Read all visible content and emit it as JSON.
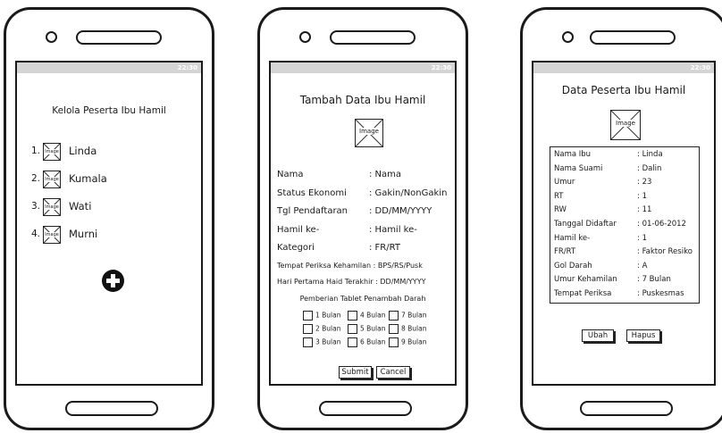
{
  "status_bar": {
    "time": "22:30"
  },
  "placeholder_image_label": "Image",
  "screen1": {
    "title": "Kelola Peserta Ibu Hamil",
    "items": [
      {
        "num": "1.",
        "name": "Linda"
      },
      {
        "num": "2.",
        "name": "Kumala"
      },
      {
        "num": "3.",
        "name": "Wati"
      },
      {
        "num": "4.",
        "name": "Murni"
      }
    ],
    "add_icon": "plus-circle-icon"
  },
  "screen2": {
    "title": "Tambah Data Ibu Hamil",
    "fields": [
      {
        "label": "Nama",
        "value": ": Nama"
      },
      {
        "label": "Status Ekonomi",
        "value": ": Gakin/NonGakin"
      },
      {
        "label": "Tgl Pendaftaran",
        "value": ": DD/MM/YYYY"
      },
      {
        "label": "Hamil ke-",
        "value": ": Hamil ke-"
      },
      {
        "label": "Kategori",
        "value": ": FR/RT"
      }
    ],
    "tempat_periksa": "Tempat Periksa Kehamilan : BPS/RS/Pusk",
    "hari_pertama_haid": "Hari Pertama Haid Terakhir : DD/MM/YYYY",
    "tablet_title": "Pemberian Tablet Penambah Darah",
    "checkbox_rows": [
      [
        "1 Bulan",
        "4 Bulan",
        "7 Bulan"
      ],
      [
        "2 Bulan",
        "5 Bulan",
        "8 Bulan"
      ],
      [
        "3 Bulan",
        "6 Bulan",
        "9 Bulan"
      ]
    ],
    "submit_label": "Submit",
    "cancel_label": "Cancel"
  },
  "screen3": {
    "title": "Data Peserta Ibu Hamil",
    "rows": [
      {
        "label": "Nama Ibu",
        "value": ": Linda"
      },
      {
        "label": "Nama Suami",
        "value": ": Dalin"
      },
      {
        "label": "Umur",
        "value": ": 23"
      },
      {
        "label": "RT",
        "value": ": 1"
      },
      {
        "label": "RW",
        "value": ": 11"
      },
      {
        "label": "Tanggal Didaftar",
        "value": ": 01-06-2012"
      },
      {
        "label": "Hamil ke-",
        "value": ": 1"
      },
      {
        "label": "FR/RT",
        "value": ": Faktor Resiko"
      },
      {
        "label": "Gol Darah",
        "value": ": A"
      },
      {
        "label": "Umur Kehamilan",
        "value": ": 7 Bulan"
      },
      {
        "label": "Tempat Periksa",
        "value": ": Puskesmas"
      }
    ],
    "edit_label": "Ubah",
    "delete_label": "Hapus"
  }
}
